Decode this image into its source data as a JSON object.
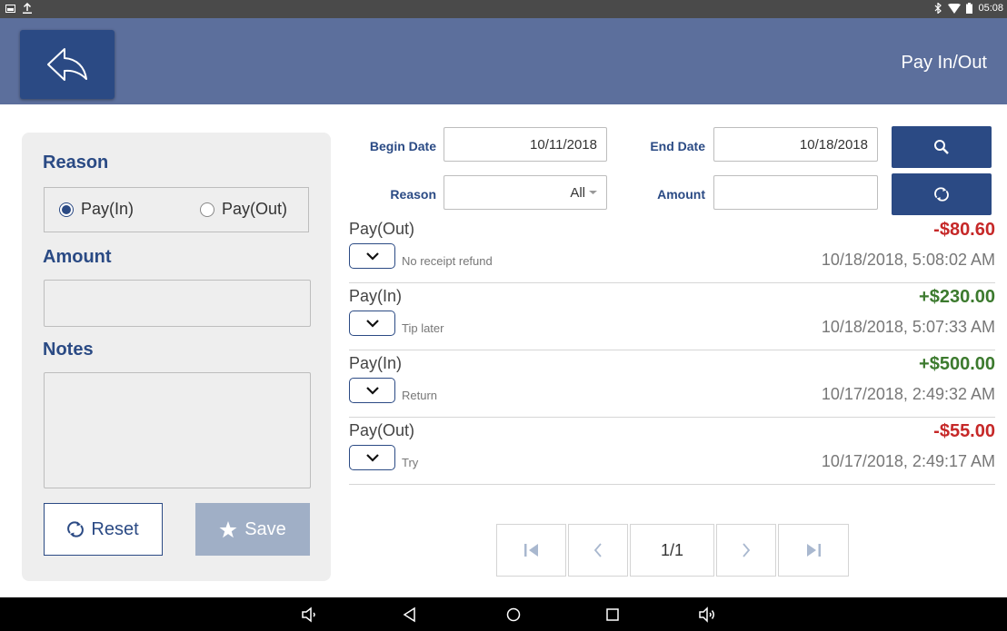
{
  "status_bar": {
    "time": "05:08",
    "icons": [
      "screen-icon",
      "upload-icon",
      "bluetooth-icon",
      "wifi-icon",
      "battery-icon"
    ]
  },
  "header": {
    "title": "Pay In/Out",
    "back_icon": "back-arrow-icon"
  },
  "form": {
    "reason_label": "Reason",
    "option_in": "Pay(In)",
    "option_out": "Pay(Out)",
    "selected": "Pay(In)",
    "amount_label": "Amount",
    "amount_value": "",
    "notes_label": "Notes",
    "notes_value": "",
    "reset_label": "Reset",
    "save_label": "Save"
  },
  "filters": {
    "begin_label": "Begin Date",
    "begin_value": "10/11/2018",
    "end_label": "End Date",
    "end_value": "10/18/2018",
    "reason_label": "Reason",
    "reason_value": "All",
    "amount_label": "Amount",
    "amount_value": ""
  },
  "transactions": [
    {
      "type": "Pay(Out)",
      "note": "No receipt refund",
      "amount": "-$80.60",
      "timestamp": "10/18/2018, 5:08:02 AM",
      "sign": "neg"
    },
    {
      "type": "Pay(In)",
      "note": "Tip later",
      "amount": "+$230.00",
      "timestamp": "10/18/2018, 5:07:33 AM",
      "sign": "pos"
    },
    {
      "type": "Pay(In)",
      "note": "Return",
      "amount": "+$500.00",
      "timestamp": "10/17/2018, 2:49:32 AM",
      "sign": "pos"
    },
    {
      "type": "Pay(Out)",
      "note": "Try",
      "amount": "-$55.00",
      "timestamp": "10/17/2018, 2:49:17 AM",
      "sign": "neg"
    }
  ],
  "pagination": {
    "page_label": "1/1"
  },
  "colors": {
    "primary": "#2b4a84",
    "header_bg": "#5c6f9c",
    "negative": "#c62828",
    "positive": "#3c7a2e",
    "save_disabled": "#a0afc6"
  }
}
